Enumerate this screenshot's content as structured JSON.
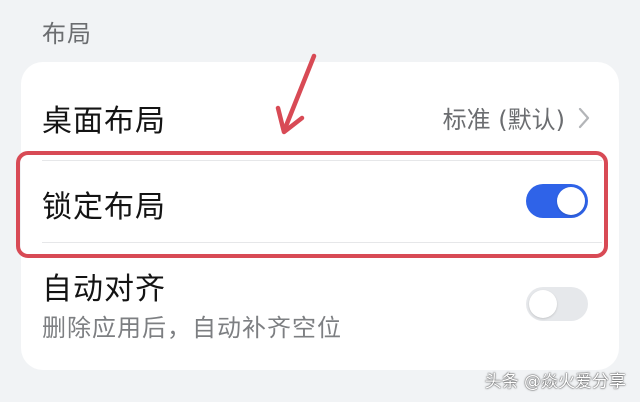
{
  "section": {
    "title": "布局"
  },
  "rows": [
    {
      "title": "桌面布局",
      "value": "标准 (默认)"
    },
    {
      "title": "锁定布局",
      "toggle_on": true
    },
    {
      "title": "自动对齐",
      "subtitle": "删除应用后，自动补齐空位",
      "toggle_on": false
    }
  ],
  "colors": {
    "accent": "#2f63e8",
    "toggle_off": "#e6e8eb",
    "annotation": "#d84a55",
    "background": "#f1f3f5"
  },
  "icons": {
    "chevron": "chevron-right-icon",
    "annotation_arrow": "arrow-down-icon"
  },
  "watermark": "头条 @焱火爱分享"
}
